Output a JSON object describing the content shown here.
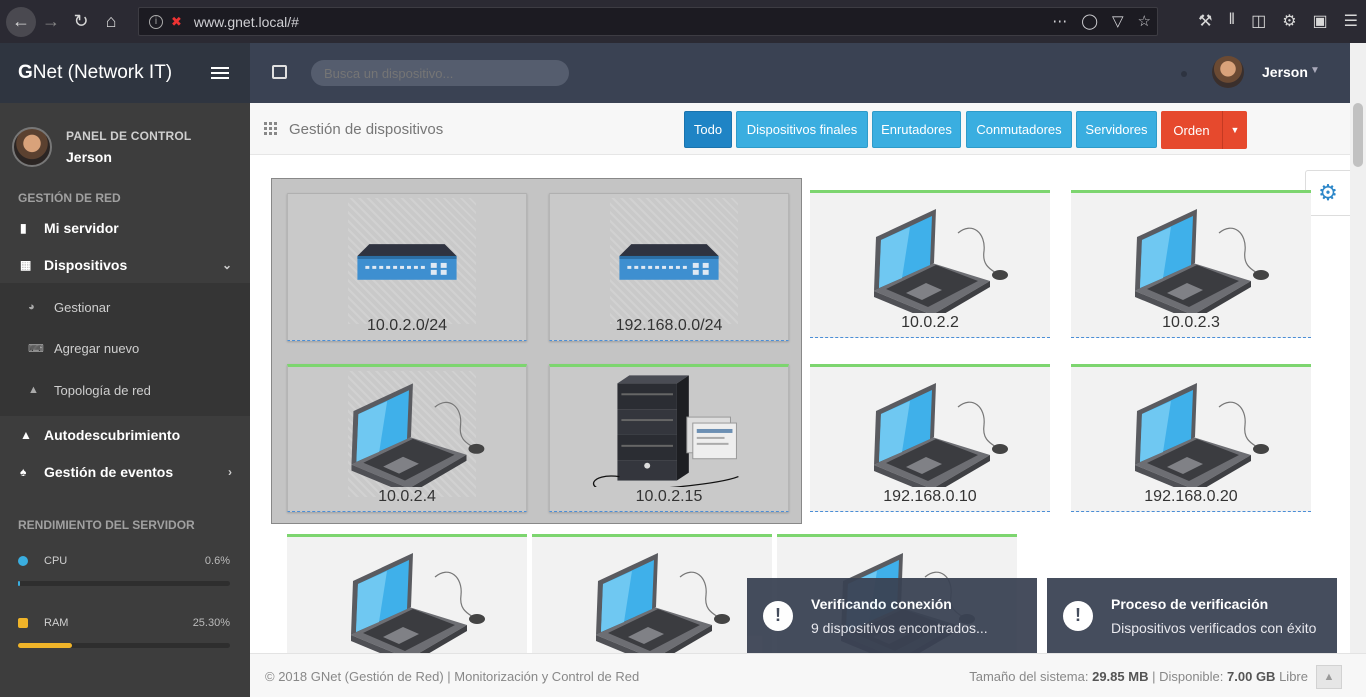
{
  "browser": {
    "url": "www.gnet.local/#"
  },
  "brand": {
    "initial": "G",
    "rest": "Net (Network IT)"
  },
  "profile": {
    "title": "PANEL DE CONTROL",
    "name": "Jerson"
  },
  "sidebar": {
    "section_network": "GESTIÓN DE RED",
    "items": [
      {
        "label": "Mi servidor",
        "icon": "server-icon"
      },
      {
        "label": "Dispositivos",
        "icon": "grid-icon"
      },
      {
        "label": "Gestionar",
        "icon": "dashboard-icon"
      },
      {
        "label": "Agregar nuevo",
        "icon": "keyboard-icon"
      },
      {
        "label": "Topología de red",
        "icon": "sitemap-icon"
      },
      {
        "label": "Autodescubrimiento",
        "icon": "sitemap-icon"
      },
      {
        "label": "Gestión de eventos",
        "icon": "bell-icon"
      }
    ],
    "section_performance": "RENDIMIENTO DEL SERVIDOR",
    "metrics": [
      {
        "label": "CPU",
        "value": "0.6%",
        "fraction": 0.006,
        "color": "#3aaee0"
      },
      {
        "label": "RAM",
        "value": "25.30%",
        "fraction": 0.253,
        "color": "#f0b429"
      }
    ]
  },
  "topbar": {
    "search_placeholder": "Busca un dispositivo...",
    "user": "Jerson"
  },
  "content": {
    "title": "Gestión de dispositivos",
    "filters": [
      "Todo",
      "Dispositivos finales",
      "Enrutadores",
      "Conmutadores",
      "Servidores"
    ],
    "active_filter": "Todo",
    "order_label": "Orden"
  },
  "devices": [
    {
      "label": "10.0.2.0/24",
      "type": "switch"
    },
    {
      "label": "192.168.0.0/24",
      "type": "switch"
    },
    {
      "label": "10.0.2.2",
      "type": "laptop"
    },
    {
      "label": "10.0.2.3",
      "type": "laptop"
    },
    {
      "label": "10.0.2.4",
      "type": "laptop"
    },
    {
      "label": "10.0.2.15",
      "type": "server"
    },
    {
      "label": "192.168.0.10",
      "type": "laptop"
    },
    {
      "label": "192.168.0.20",
      "type": "laptop"
    },
    {
      "label": "",
      "type": "laptop"
    },
    {
      "label": "",
      "type": "laptop"
    },
    {
      "label": "",
      "type": "laptop"
    }
  ],
  "notifications": [
    {
      "title": "Verificando conexión",
      "body": "9 dispositivos encontrados..."
    },
    {
      "title": "Proceso de verificación",
      "body": "Dispositivos verificados con éxito"
    }
  ],
  "footer": {
    "left": "© 2018 GNet (Gestión de Red) | Monitorización y Control de Red",
    "size_label": "Tamaño del sistema:",
    "size_value": "29.85 MB",
    "avail_label": "| Disponible:",
    "avail_value": "7.00 GB",
    "free_label": "Libre"
  }
}
